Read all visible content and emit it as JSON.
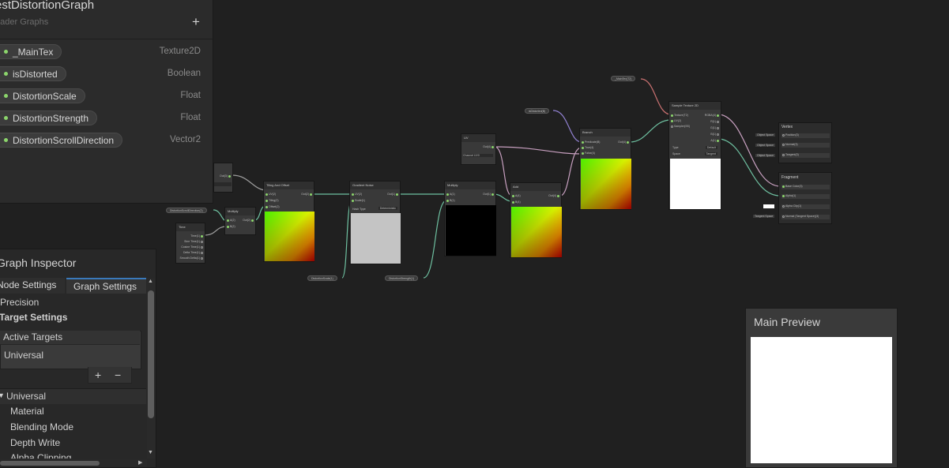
{
  "blackboard": {
    "title": "estDistortionGraph",
    "subtitle": "hader Graphs",
    "add_label": "+",
    "properties": [
      {
        "name": "_MainTex",
        "type": "Texture2D"
      },
      {
        "name": "isDistorted",
        "type": "Boolean"
      },
      {
        "name": "DistortionScale",
        "type": "Float"
      },
      {
        "name": "DistortionStrength",
        "type": "Float"
      },
      {
        "name": "DistortionScrollDirection",
        "type": "Vector2"
      }
    ]
  },
  "inspector": {
    "title": "Graph Inspector",
    "tabs": {
      "node": "Node Settings",
      "graph": "Graph Settings"
    },
    "precision_label": "Precision",
    "target_settings_label": "Target Settings",
    "active_targets_label": "Active Targets",
    "active_target": "Universal",
    "add_label": "+",
    "remove_label": "−",
    "universal_section": "Universal",
    "settings": [
      "Material",
      "Blending Mode",
      "Depth Write",
      "Alpha Clipping"
    ]
  },
  "preview": {
    "title": "Main Preview"
  },
  "nodes": {
    "partial": {
      "out": "Out(3)"
    },
    "tiling": {
      "title": "Tiling And Offset",
      "in": [
        "UV(2)",
        "Tiling(2)",
        "Offset(2)"
      ],
      "out": "Out(2)"
    },
    "gradient": {
      "title": "Gradient Noise",
      "in": [
        "UV(2)",
        "Scale(1)"
      ],
      "out": "Out(1)",
      "hash_label": "Hash Type",
      "hash_value": "Deterministic"
    },
    "multiply1": {
      "title": "Multiply",
      "in": [
        "A(2)",
        "B(2)"
      ],
      "out": "Out(2)"
    },
    "multiply2": {
      "title": "Multiply",
      "in": [
        "A(1)",
        "B(1)"
      ],
      "out": "Out(1)"
    },
    "time": {
      "title": "Time",
      "out": [
        "Time(1)",
        "Sine Time(1)",
        "Cosine Time(1)",
        "Delta Time(1)",
        "Smooth Delta(1)"
      ]
    },
    "uv": {
      "title": "UV",
      "out": "Out(4)",
      "channel": "Channel UV0"
    },
    "add": {
      "title": "Add",
      "in": [
        "A(4)",
        "B(4)"
      ],
      "out": "Out(4)"
    },
    "branch": {
      "title": "Branch",
      "in": [
        "Predicate(B)",
        "True(4)",
        "False(4)"
      ],
      "out": "Out(4)"
    },
    "sample": {
      "title": "Sample Texture 2D",
      "in": [
        "Texture(T2)",
        "UV(2)",
        "Sampler(SS)"
      ],
      "out": [
        "RGBA(4)",
        "R(1)",
        "G(1)",
        "B(1)",
        "A(1)"
      ],
      "type_label": "Type",
      "type_value": "Default",
      "space_label": "Space",
      "space_value": "Tangent"
    },
    "vertex": {
      "title": "Vertex",
      "ports": [
        "Position(3)",
        "Normal(3)",
        "Tangent(3)"
      ],
      "space": "Object Space"
    },
    "fragment": {
      "title": "Fragment",
      "ports": [
        "Base Color(3)",
        "Alpha(1)",
        "Alpha Clip(1)",
        "Normal (Tangent Space)(3)"
      ],
      "space": "Tangent Space"
    }
  },
  "property_nodes": {
    "scroll": "DistortionScrollDirection(2)",
    "maintex": "_MainTex(T2)",
    "distorted": "isDistorted(B)",
    "scale": "DistortionScale(1)",
    "strength": "DistortionStrength(1)"
  },
  "colors": {
    "background": "#202020",
    "panel": "#2b2b2b",
    "accent": "#3a79bb",
    "property_dot": "#8cd66c",
    "wire_green": "#6ec0a0",
    "wire_pink": "#c8a0c0",
    "wire_purple": "#9080d0",
    "wire_red": "#c87070"
  }
}
